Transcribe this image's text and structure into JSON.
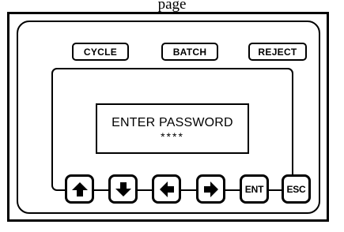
{
  "header": {
    "title": "page"
  },
  "top_buttons": {
    "cycle": "CYCLE",
    "batch": "BATCH",
    "reject": "REJECT"
  },
  "display": {
    "line1": "ENTER PASSWORD",
    "line2": "****"
  },
  "keypad": {
    "up_icon": "arrow-up-icon",
    "down_icon": "arrow-down-icon",
    "left_icon": "arrow-left-icon",
    "right_icon": "arrow-right-icon",
    "enter": "ENT",
    "escape": "ESC"
  }
}
